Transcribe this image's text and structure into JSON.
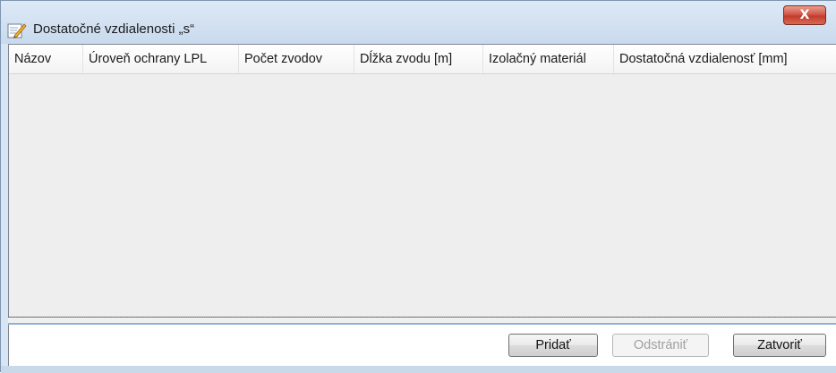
{
  "window": {
    "title": "Dostatočné vzdialenosti „s“",
    "close_label": "X"
  },
  "table": {
    "columns": [
      "Názov",
      "Úroveň ochrany LPL",
      "Počet zvodov",
      "Dĺžka zvodu [m]",
      "Izolačný materiál",
      "Dostatočná vzdialenosť [mm]"
    ],
    "rows": []
  },
  "buttons": {
    "add": "Pridať",
    "remove": "Odstrániť",
    "close": "Zatvoriť"
  },
  "icons": {
    "window_icon": "edit-pencil-icon",
    "close_icon": "close-icon"
  },
  "colors": {
    "close_button": "#c94a3a",
    "title_bar": "#d0dff0",
    "list_background": "#eeeeee"
  }
}
